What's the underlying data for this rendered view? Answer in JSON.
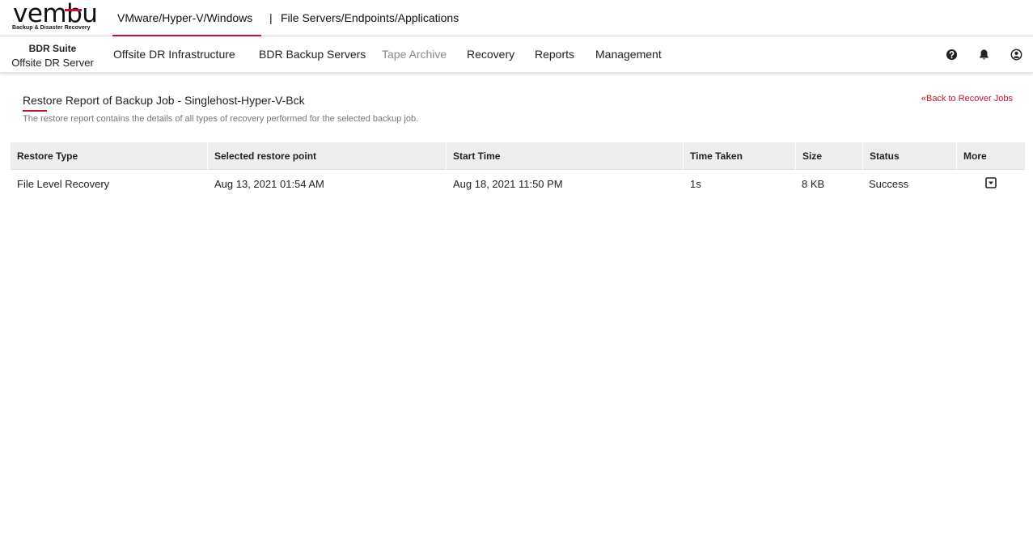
{
  "logo": {
    "wordmark": "vembu",
    "tagline": "Backup & Disaster Recovery"
  },
  "product_tabs": [
    {
      "label": "VMware/Hyper-V/Windows",
      "active": true
    },
    {
      "label": "File Servers/Endpoints/Applications",
      "active": false
    }
  ],
  "tab_separator": "|",
  "brand": {
    "top": "BDR Suite",
    "bottom": "Offsite DR Server"
  },
  "nav": [
    {
      "label": "Offsite DR Infrastructure",
      "disabled": false
    },
    {
      "label": "BDR Backup Servers",
      "disabled": false
    },
    {
      "label": "Tape Archive",
      "disabled": true
    },
    {
      "label": "Recovery",
      "disabled": false
    },
    {
      "label": "Reports",
      "disabled": false
    },
    {
      "label": "Management",
      "disabled": false
    }
  ],
  "header_icons": [
    "help-icon",
    "bell-icon",
    "user-icon"
  ],
  "page": {
    "title": "Restore Report of Backup Job - Singlehost-Hyper-V-Bck",
    "subtitle": "The restore report contains the details of all types of recovery performed for the selected backup job.",
    "back_link": "«Back to Recover Jobs"
  },
  "table": {
    "columns": [
      "Restore Type",
      "Selected restore point",
      "Start Time",
      "Time Taken",
      "Size",
      "Status",
      "More"
    ],
    "rows": [
      [
        "File Level Recovery",
        "Aug 13, 2021 01:54 AM",
        "Aug 18, 2021 11:50 PM",
        "1s",
        "8 KB",
        "Success"
      ]
    ]
  },
  "colors": {
    "accent": "#c8102e",
    "header_bg": "#eeeeee",
    "muted_text": "#777777",
    "disabled_text": "#8a8a8a"
  }
}
